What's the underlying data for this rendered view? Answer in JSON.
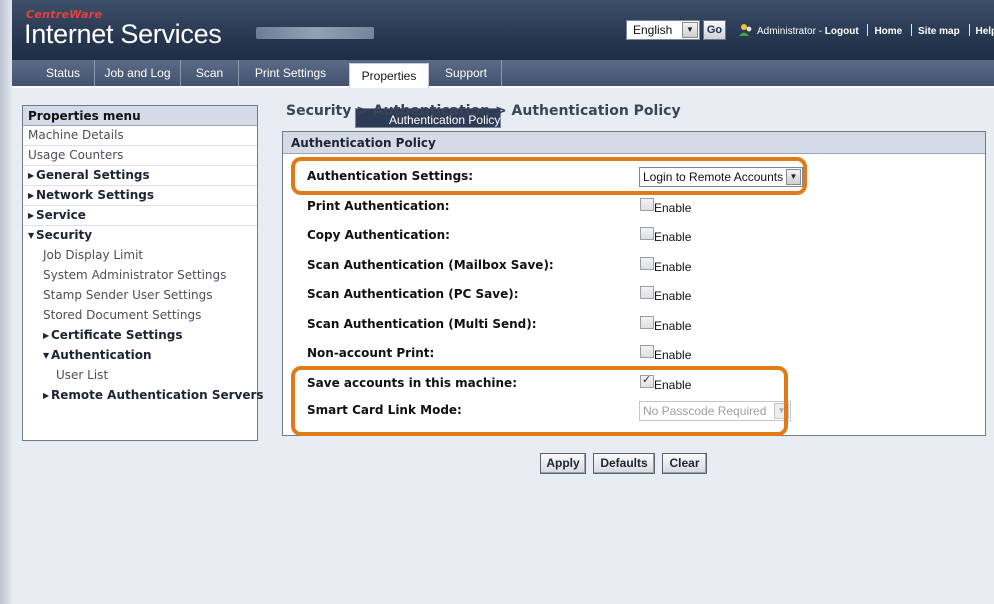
{
  "header": {
    "brand_top": "CentreWare",
    "brand_main": "Internet Services",
    "language": "English",
    "go_label": "Go",
    "user": "Administrator",
    "user_sep": " - ",
    "logout": "Logout",
    "home": "Home",
    "sitemap": "Site map",
    "help": "Help..."
  },
  "tabs": [
    "Status",
    "Job and Log",
    "Scan",
    "Print Settings",
    "Properties",
    "Support"
  ],
  "active_tab": "Properties",
  "menu": {
    "title": "Properties menu",
    "items": [
      "Machine Details",
      "Usage Counters",
      "General Settings",
      "Network Settings",
      "Service",
      "Security",
      "Job Display Limit",
      "System Administrator Settings",
      "Stamp Sender User Settings",
      "Stored Document Settings",
      "Certificate Settings",
      "Authentication",
      "Authentication Policy",
      "User List",
      "Remote Authentication Servers"
    ]
  },
  "breadcrumb": "Security > Authentication > Authentication Policy",
  "panel": {
    "title": "Authentication Policy",
    "enable_label": "Enable",
    "auth_settings_label": "Authentication Settings:",
    "auth_settings_value": "Login to Remote Accounts",
    "checkbox_rows": [
      {
        "label": "Print Authentication:",
        "checked": false
      },
      {
        "label": "Copy Authentication:",
        "checked": false
      },
      {
        "label": "Scan Authentication (Mailbox Save):",
        "checked": false
      },
      {
        "label": "Scan Authentication (PC Save):",
        "checked": false
      },
      {
        "label": "Scan Authentication (Multi Send):",
        "checked": false
      },
      {
        "label": "Non-account Print:",
        "checked": false
      },
      {
        "label": "Save accounts in this machine:",
        "checked": true
      }
    ],
    "smart_card_label": "Smart Card Link Mode:",
    "smart_card_value": "No Passcode Required"
  },
  "buttons": {
    "apply": "Apply",
    "defaults": "Defaults",
    "clear": "Clear"
  },
  "colors": {
    "highlight": "#e07b18",
    "header": "#283851",
    "selected": "#2e3b56"
  }
}
